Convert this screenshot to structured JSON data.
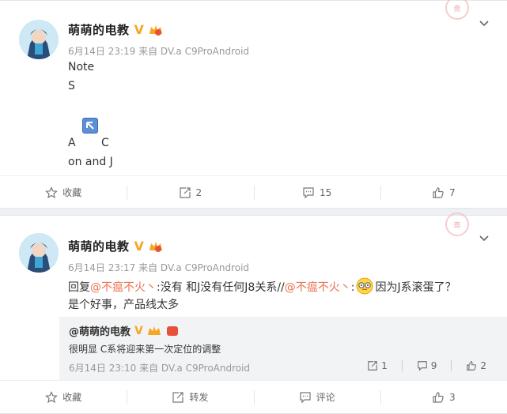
{
  "post1": {
    "author": "萌萌的电教",
    "verified_badge": "V",
    "meta": "6月14日 23:19 来自 DV.a C9ProAndroid",
    "lines": [
      "Note",
      "S",
      "A",
      "C",
      "on and J"
    ],
    "stamp_text": "斋",
    "actions": {
      "favorite": "收藏",
      "repost_count": "2",
      "comment_count": "15",
      "like_count": "7"
    }
  },
  "post2": {
    "author": "萌萌的电教",
    "verified_badge": "V",
    "meta": "6月14日 23:17 来自 DV.a C9ProAndroid",
    "reply_prefix": "回复",
    "mention1": "@不瘟不火丶",
    "text1": ":没有 和J没有任何J8关系//",
    "mention2": "@不瘟不火丶",
    "text2": ":",
    "text3": "因为J系滚蛋了？",
    "line2": "是个好事，产品线太多",
    "stamp_text": "斋",
    "quote": {
      "author": "@萌萌的电教",
      "verified_badge": "V",
      "text": "很明显 C系将迎来第一次定位的调整",
      "meta": "6月14日 23:10 来自 DV.a C9ProAndroid",
      "repost_count": "1",
      "comment_count": "9",
      "like_count": "2"
    },
    "actions": {
      "favorite": "收藏",
      "repost": "转发",
      "comment": "评论",
      "like_count": "3"
    }
  }
}
